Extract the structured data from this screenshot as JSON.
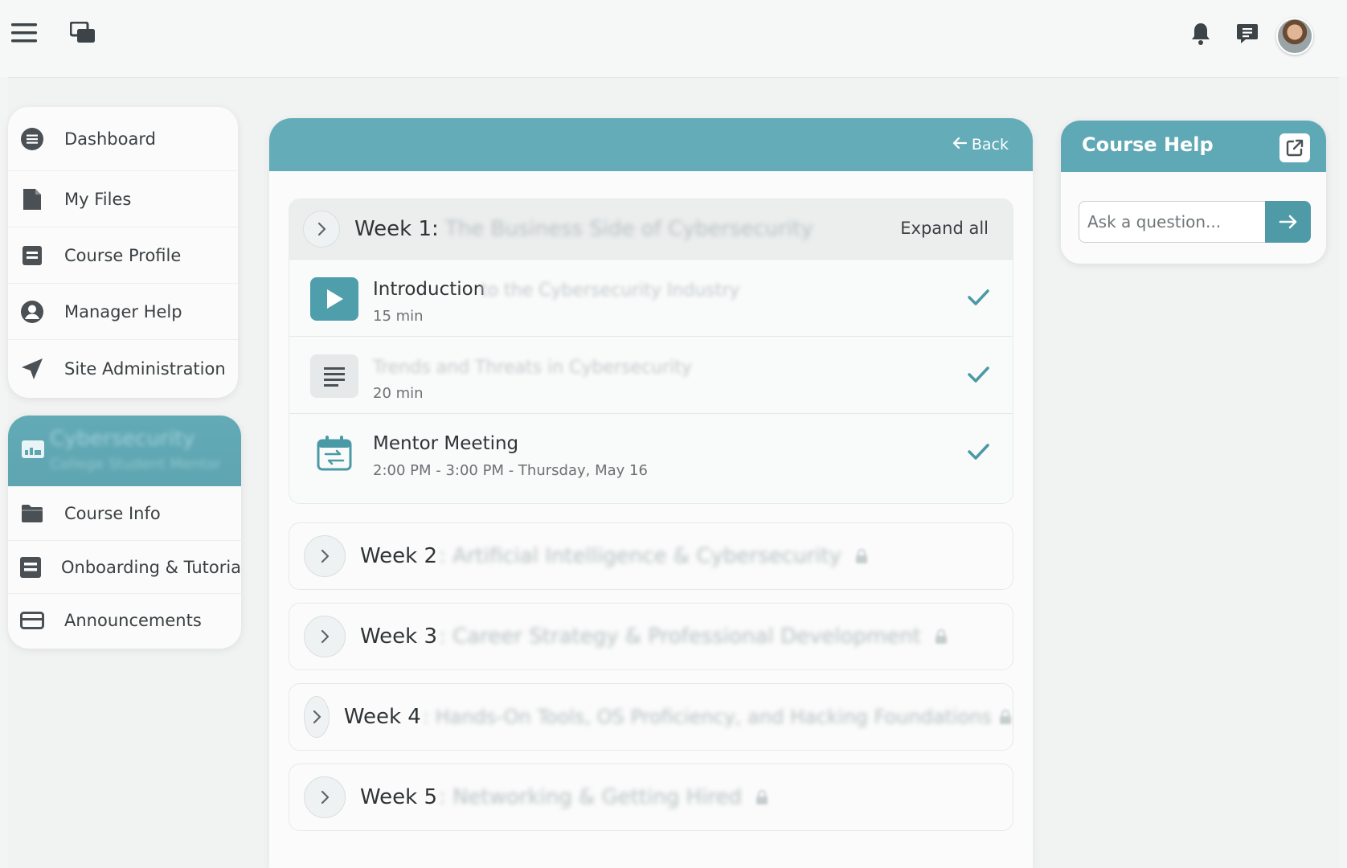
{
  "topbar": {
    "icons": [
      "menu-icon",
      "windows-icon",
      "bell-icon",
      "chat-icon"
    ],
    "avatar": "user-avatar"
  },
  "sidebar": {
    "items": [
      {
        "label": "Dashboard",
        "icon": "list-circle-icon"
      },
      {
        "label": "My Files",
        "icon": "file-icon"
      },
      {
        "label": "Course Profile",
        "icon": "profile-card-icon"
      },
      {
        "label": "Manager Help",
        "icon": "user-circle-icon"
      },
      {
        "label": "Site Administration",
        "icon": "navigation-arrow-icon"
      }
    ],
    "course": {
      "title": "Cybersecurity",
      "subtitle": "College Student Mentor",
      "icon": "chalkboard-icon"
    },
    "course_items": [
      {
        "label": "Course Info",
        "icon": "folder-icon"
      },
      {
        "label": "Onboarding & Tutorial",
        "icon": "tutorial-icon"
      },
      {
        "label": "Announcements",
        "icon": "card-icon"
      }
    ]
  },
  "main": {
    "back_label": "Back",
    "expand_all_label": "Expand all",
    "week1": {
      "label": "Week 1:",
      "title": "The Business Side of Cybersecurity",
      "lessons": [
        {
          "title": "Introduction",
          "title_rest": "to the Cybersecurity Industry",
          "meta": "15 min",
          "icon": "video-play-icon",
          "done": true
        },
        {
          "title": "",
          "title_rest": "Trends and Threats in Cybersecurity",
          "meta": "20 min",
          "icon": "document-icon",
          "done": true
        },
        {
          "title": "Mentor Meeting",
          "title_rest": "",
          "meta": "2:00 PM - 3:00 PM - Thursday, May 16",
          "icon": "calendar-icon",
          "done": true
        }
      ]
    },
    "weeks": [
      {
        "label": "Week 2",
        "title": ": Artificial Intelligence & Cybersecurity"
      },
      {
        "label": "Week 3",
        "title": ": Career Strategy & Professional Development"
      },
      {
        "label": "Week 4",
        "title": ": Hands-On Tools, OS Proficiency, and Hacking Foundations"
      },
      {
        "label": "Week 5",
        "title": ": Networking & Getting Hired"
      }
    ]
  },
  "help": {
    "title": "Course Help",
    "placeholder": "Ask a question..."
  },
  "colors": {
    "accent": "#5ea9b5",
    "accent_dark": "#4f9aa7",
    "check": "#4a99a6",
    "background": "#f3f4f4"
  }
}
